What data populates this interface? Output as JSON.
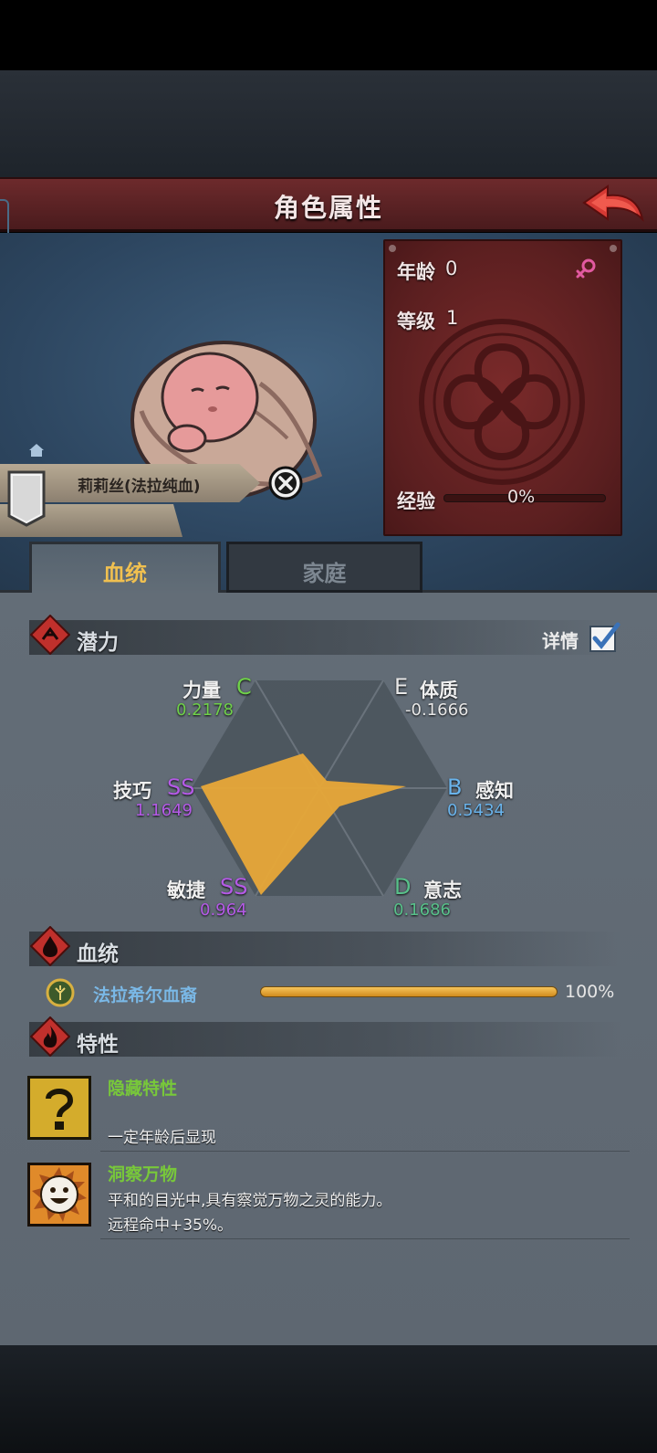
{
  "header": {
    "title": "角色属性",
    "back_icon": "back-arrow-icon"
  },
  "character": {
    "name": "莉莉丝(法拉纯血)"
  },
  "stats": {
    "age_label": "年龄",
    "age_value": "0",
    "level_label": "等级",
    "level_value": "1",
    "exp_label": "经验",
    "exp_value": "0%",
    "exp_fraction": 0,
    "gender_icon": "female-icon"
  },
  "tabs": [
    {
      "label": "血统",
      "active": true
    },
    {
      "label": "家庭",
      "active": false
    }
  ],
  "potential": {
    "title": "潜力",
    "detail_label": "详情",
    "detail_checked": true,
    "attributes": [
      {
        "name": "力量",
        "grade": "C",
        "value": "0.2178",
        "grade_color": "#6fd04a"
      },
      {
        "name": "体质",
        "grade": "E",
        "value": "-0.1666",
        "grade_color": "#e8e8e8"
      },
      {
        "name": "感知",
        "grade": "B",
        "value": "0.5434",
        "grade_color": "#6ab4ec"
      },
      {
        "name": "意志",
        "grade": "D",
        "value": "0.1686",
        "grade_color": "#58c08a"
      },
      {
        "name": "敏捷",
        "grade": "SS",
        "value": "0.964",
        "grade_color": "#b45ae6"
      },
      {
        "name": "技巧",
        "grade": "SS",
        "value": "1.1649",
        "grade_color": "#b45ae6"
      }
    ]
  },
  "bloodline": {
    "title": "血统",
    "name": "法拉希尔血裔",
    "percent": "100%",
    "fraction": 1
  },
  "traits": {
    "title": "特性",
    "items": [
      {
        "name": "隐藏特性",
        "desc1": "一定年龄后显现",
        "desc2": "",
        "icon": "question-mark-icon"
      },
      {
        "name": "洞察万物",
        "desc1": "平和的目光中,具有察觉万物之灵的能力。",
        "desc2": "远程命中+35%。",
        "icon": "smiling-sun-icon"
      }
    ]
  },
  "colors": {
    "accent_gold": "#f0c050",
    "header_red": "#6d2a2c",
    "radar_fill": "#e8a838"
  }
}
